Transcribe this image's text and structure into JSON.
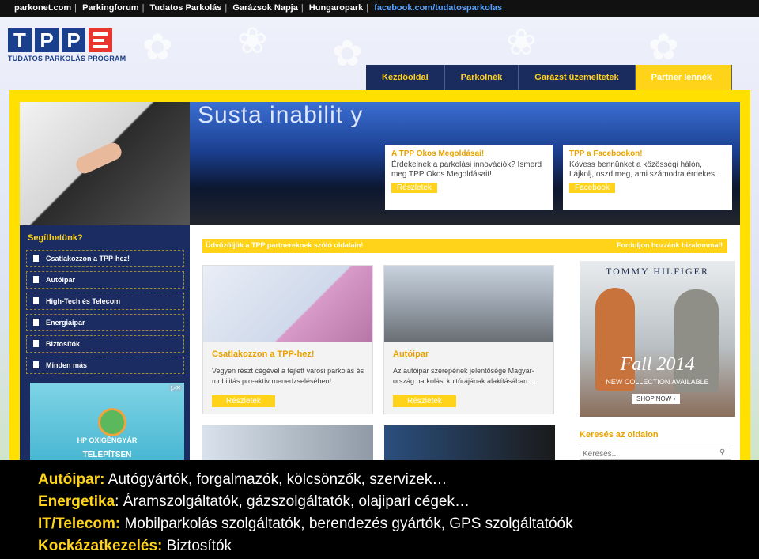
{
  "topbar": {
    "links": [
      "parkonet.com",
      "Parkingforum",
      "Tudatos Parkolás",
      "Garázsok Napja",
      "Hungaropark"
    ],
    "facebook": "facebook.com/tudatosparkolas"
  },
  "logo": {
    "letters": "TPP",
    "subtitle": "TUDATOS PARKOLÁS PROGRAM"
  },
  "nav": {
    "items": [
      {
        "label": "Kezdőoldal"
      },
      {
        "label": "Parkolnék"
      },
      {
        "label": "Garázst üzemeltetek"
      },
      {
        "label": "Partner lennék"
      }
    ]
  },
  "hero": {
    "banner_text": "Susta inabilit y",
    "box1": {
      "title": "A TPP Okos Megoldásai!",
      "text": "Érdekelnek a parkolási innovációk? Ismerd meg TPP Okos Megoldásait!",
      "button": "Részletek"
    },
    "box2": {
      "title": "TPP a Facebookon!",
      "text": "Kövess bennünket a közösségi hálón, Lájkolj, oszd meg, ami számodra érdekes!",
      "button": "Facebook"
    }
  },
  "sidebar": {
    "heading": "Segíthetünk?",
    "items": [
      {
        "label": "Csatlakozzon a TPP-hez!"
      },
      {
        "label": "Autóipar"
      },
      {
        "label": "High-Tech és Telecom"
      },
      {
        "label": "Energiaipar"
      },
      {
        "label": "Biztosítók"
      },
      {
        "label": "Minden más"
      }
    ],
    "ad": {
      "line1": "HP OXIGÉNGYÁR",
      "line2": "TELEPÍTSEN"
    }
  },
  "main": {
    "welcome_left": "Üdvözöljük a TPP partnereknek szóló oldalain!",
    "welcome_right": "Forduljon hozzánk bizalommal!",
    "cards": [
      {
        "title": "Csatlakozzon a TPP-hez!",
        "text": "Vegyen részt cégével a fejlett városi parkolás és mobilitás pro-aktív menedzselésében!",
        "button": "Részletek"
      },
      {
        "title": "Autóipar",
        "text": "Az autóipar szerepének jelentősége Magyar- ország parkolási kultúrájának alakításában...",
        "button": "Részletek"
      }
    ]
  },
  "ad": {
    "brand": "TOMMY HILFIGER",
    "headline": "Fall 2014",
    "sub": "NEW COLLECTION AVAILABLE",
    "cta": "SHOP NOW ›"
  },
  "search": {
    "heading": "Keresés az oldalon",
    "placeholder": "Keresés..."
  },
  "overlay": {
    "lines": [
      {
        "key": "Autóipar:",
        "text": " Autógyártók, forgalmazók, kölcsönzők, szervizek…"
      },
      {
        "key": "Energetika",
        "text": ": Áramszolgáltatók, gázszolgáltatók, olajipari cégek…"
      },
      {
        "key": "IT/Telecom:",
        "text": " Mobilparkolás szolgáltatók, berendezés gyártók, GPS szolgáltatóók"
      },
      {
        "key": "Kockázatkezelés:",
        "text": " Biztosítók"
      }
    ]
  },
  "colors": {
    "accent": "#ffd31a",
    "navy": "#1b2c62",
    "brand_red": "#e8352d"
  }
}
